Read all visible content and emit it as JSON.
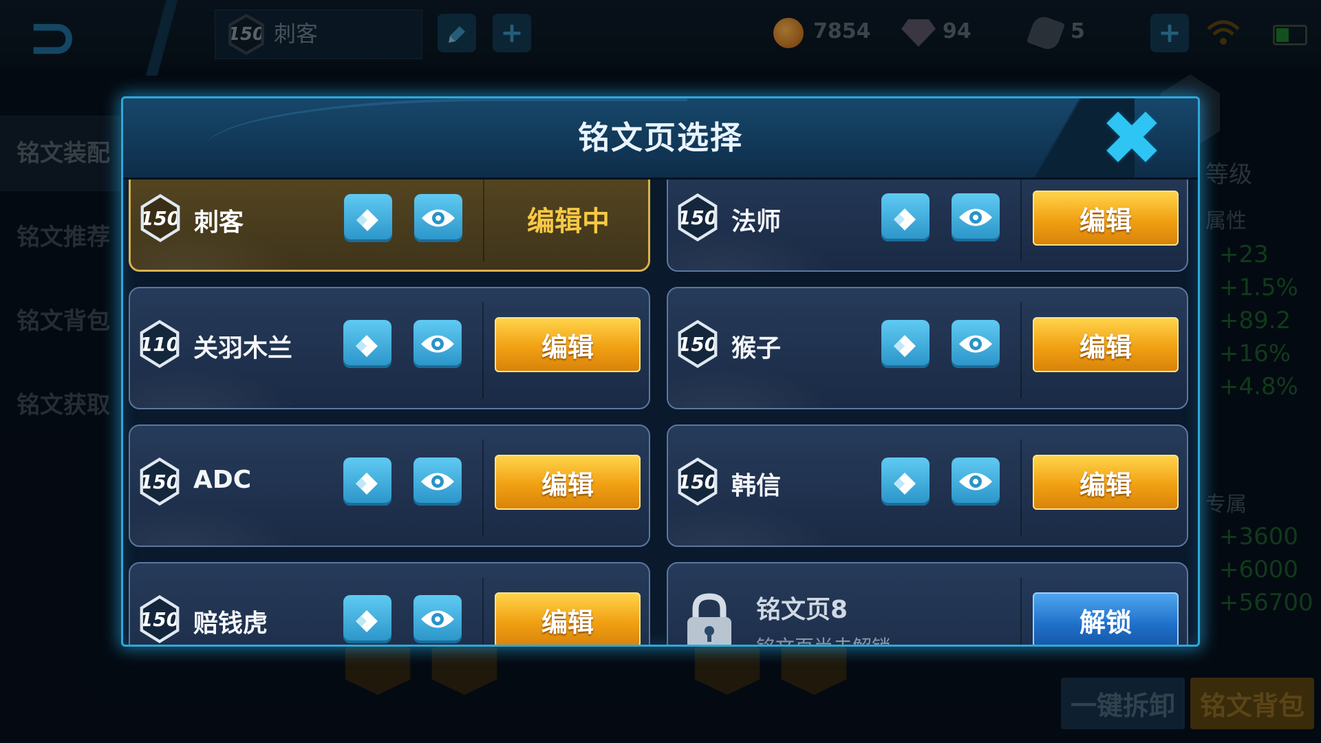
{
  "topbar": {
    "back_icon": "back-arrow-icon",
    "page_level": "150",
    "page_name": "刺客",
    "edit_icon": "pencil-icon",
    "add_label": "+",
    "gold": "7854",
    "gems": "94",
    "fragments": "5",
    "add_currency_label": "+"
  },
  "left_tabs": [
    "铭文装配",
    "铭文推荐",
    "铭文背包",
    "铭文获取"
  ],
  "right_panel": {
    "level_label": "等级",
    "attr_label": "属性",
    "stats": [
      "+23",
      "+1.5%",
      "+89.2",
      "+16%",
      "+4.8%"
    ],
    "exclusive_label": "专属",
    "stats2": [
      "+3600",
      "+6000",
      "+56700"
    ]
  },
  "bottom_buttons": {
    "unload_all": "一键拆卸",
    "backpack": "铭文背包"
  },
  "modal": {
    "title": "铭文页选择",
    "close_icon": "close-x-icon",
    "pages": [
      {
        "level": "150",
        "name": "刺客",
        "button": "编辑中",
        "state": "editing"
      },
      {
        "level": "150",
        "name": "法师",
        "button": "编辑",
        "state": "normal"
      },
      {
        "level": "110",
        "name": "关羽木兰",
        "button": "编辑",
        "state": "normal"
      },
      {
        "level": "150",
        "name": "猴子",
        "button": "编辑",
        "state": "normal"
      },
      {
        "level": "150",
        "name": "ADC",
        "button": "编辑",
        "state": "normal"
      },
      {
        "level": "150",
        "name": "韩信",
        "button": "编辑",
        "state": "normal"
      },
      {
        "level": "150",
        "name": "赔钱虎",
        "button": "编辑",
        "state": "normal"
      }
    ],
    "locked_page": {
      "name": "铭文页8",
      "subtitle": "铭文页尚未解锁",
      "button": "解锁",
      "icon": "padlock-icon"
    }
  },
  "colors": {
    "accent_blue": "#2fa8da",
    "edit_orange": "#f1a013",
    "unlock_blue": "#1f6fc9",
    "active_gold": "#d9b24e",
    "stat_green": "#1b5a2b"
  }
}
